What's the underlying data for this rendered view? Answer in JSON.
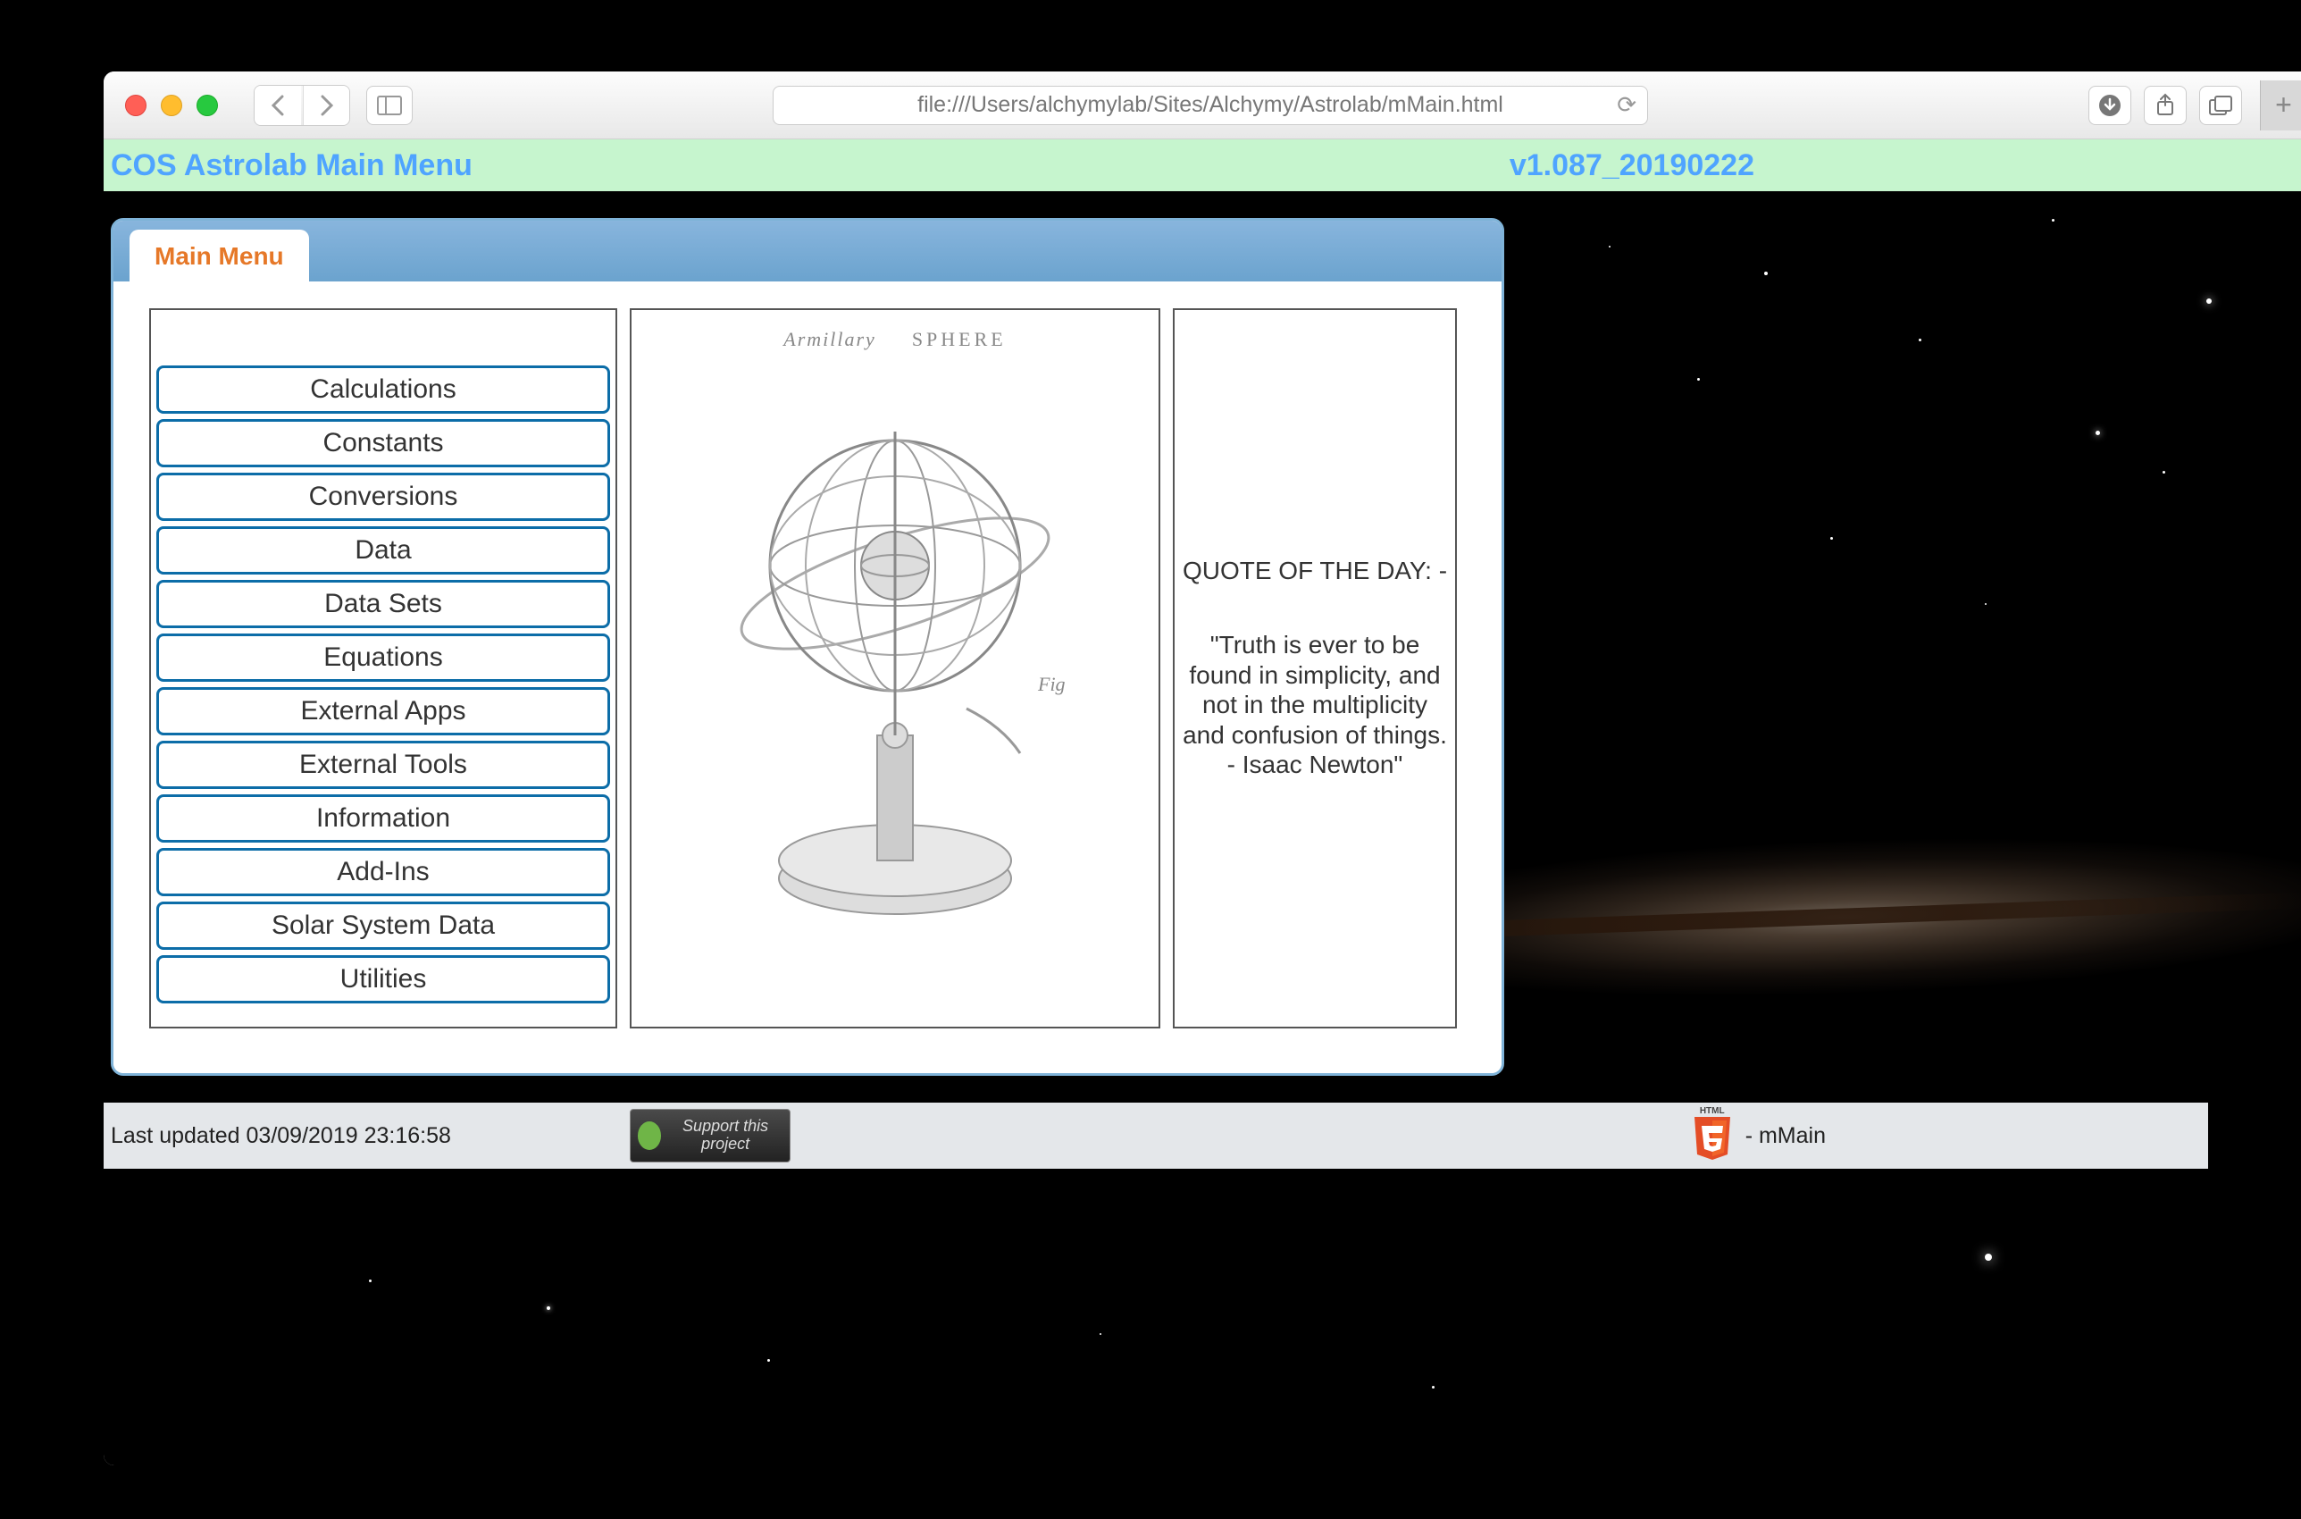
{
  "browser": {
    "url": "file:///Users/alchymylab/Sites/Alchymy/Astrolab/mMain.html"
  },
  "header": {
    "title": "COS Astrolab Main Menu",
    "version": "v1.087_20190222"
  },
  "tab": {
    "label": "Main Menu"
  },
  "menu": {
    "items": [
      "Calculations",
      "Constants",
      "Conversions",
      "Data",
      "Data Sets",
      "Equations",
      "External Apps",
      "External Tools",
      "Information",
      "Add-Ins",
      "Solar System Data",
      "Utilities"
    ]
  },
  "illustration": {
    "label_left": "Armillary",
    "label_right": "SPHERE",
    "fig_label": "Fig"
  },
  "quote": {
    "heading": "QUOTE OF THE DAY: -",
    "text": "\"Truth is ever to be found in simplicity, and not in the multiplicity and confusion of things. - Isaac Newton\""
  },
  "footer": {
    "last_updated": "Last updated 03/09/2019 23:16:58",
    "support_text": "Support this project",
    "html5_label": "HTML",
    "page_name": "- mMain"
  }
}
